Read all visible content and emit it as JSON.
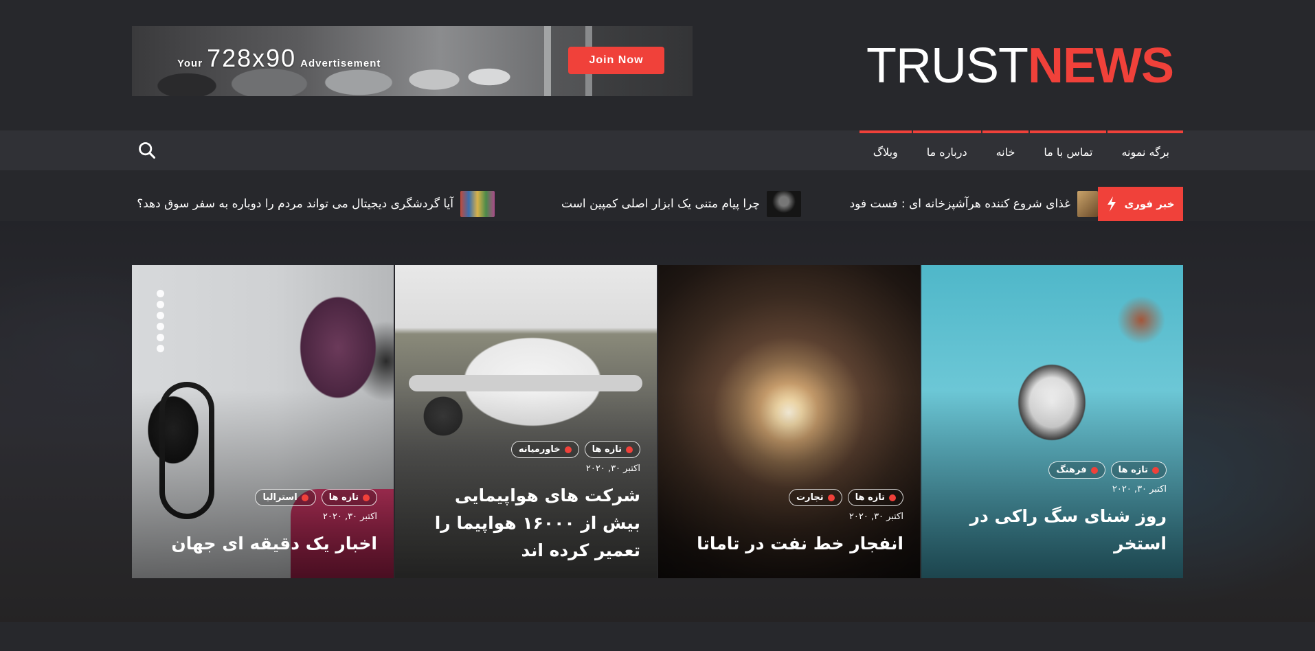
{
  "header": {
    "ad": {
      "prefix": "Your",
      "size": "728x90",
      "suffix": "Advertisement",
      "cta": "Join Now"
    },
    "logo": {
      "part1": "TRUST",
      "part2": "NEWS"
    }
  },
  "nav": {
    "items": [
      {
        "label": "برگه نمونه"
      },
      {
        "label": "تماس با ما"
      },
      {
        "label": "خانه"
      },
      {
        "label": "درباره ما"
      },
      {
        "label": "وبلاگ"
      }
    ],
    "search_icon": "search-icon"
  },
  "ticker": {
    "label": "خبر فوری",
    "icon": "bolt-icon",
    "items": [
      {
        "text": "غذای شروع کننده هرآشپزخانه ای : فست فود"
      },
      {
        "text": "چرا پیام متنی یک ابزار اصلی کمپین است"
      },
      {
        "text": "آیا گردشگری دیجیتال می تواند مردم را دوباره به سفر سوق دهد؟"
      }
    ]
  },
  "cards": [
    {
      "tags": [
        "تازه ها",
        "استرالیا"
      ],
      "date": "اکتبر ۳۰, ۲۰۲۰",
      "title": "اخبار یک دقیقه ای جهان"
    },
    {
      "tags": [
        "تازه ها",
        "خاورمیانه"
      ],
      "date": "اکتبر ۳۰, ۲۰۲۰",
      "title": "شرکت های هواپیمایی بیش از ۱۶۰۰۰ هواپیما را تعمیر کرده اند"
    },
    {
      "tags": [
        "تازه ها",
        "تجارت"
      ],
      "date": "اکتبر ۳۰, ۲۰۲۰",
      "title": "انفجار خط نفت در تاماتا"
    },
    {
      "tags": [
        "تازه ها",
        "فرهنگ"
      ],
      "date": "اکتبر ۳۰, ۲۰۲۰",
      "title": "روز شنای سگ راکی در استخر"
    }
  ],
  "colors": {
    "accent": "#f0413a",
    "background": "#27282c",
    "nav": "#303136"
  }
}
